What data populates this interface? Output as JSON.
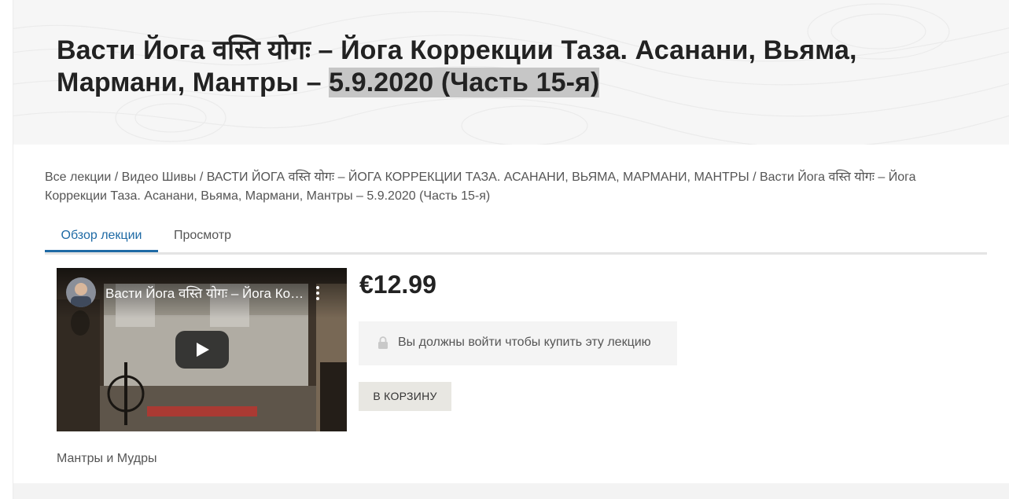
{
  "hero": {
    "title_main": "Васти Йога वस्ति योगः – Йога Коррекции Таза. Асанани, Вьяма, Мармани, Мантры – ",
    "title_highlight": "5.9.2020 (Часть 15-я)"
  },
  "breadcrumb": {
    "items": [
      "Все лекции",
      "Видео Шивы",
      "ВАСТИ ЙОГА वस्ति योगः – ЙОГА КОРРЕКЦИИ ТАЗА. АСАНАНИ, ВЬЯМА, МАРМАНИ, МАНТРЫ",
      "Васти Йога वस्ति योगः – Йога Коррекции Таза. Асанани, Вьяма, Мармани, Мантры – 5.9.2020 (Часть 15-я)"
    ],
    "separator": " / "
  },
  "tabs": [
    {
      "label": "Обзор лекции"
    },
    {
      "label": "Просмотр"
    }
  ],
  "video": {
    "title": "Васти Йога वस्ति योगः – Йога Коррекции Таза. Асанани, Вьяма, Мармани, Мантры",
    "icons": [
      "avatar",
      "kebab-menu-icon",
      "play-icon"
    ]
  },
  "product": {
    "price": "€12.99",
    "login_message": "Вы должны войти чтобы купить эту лекцию",
    "add_to_cart_label": "В КОРЗИНУ"
  },
  "category": "Мантры и Мудры",
  "colors": {
    "accent": "#1e6aa5",
    "hero_bg": "#f6f6f6",
    "highlight": "#c6c6c6",
    "cart_button_bg": "#e8e7e2"
  }
}
